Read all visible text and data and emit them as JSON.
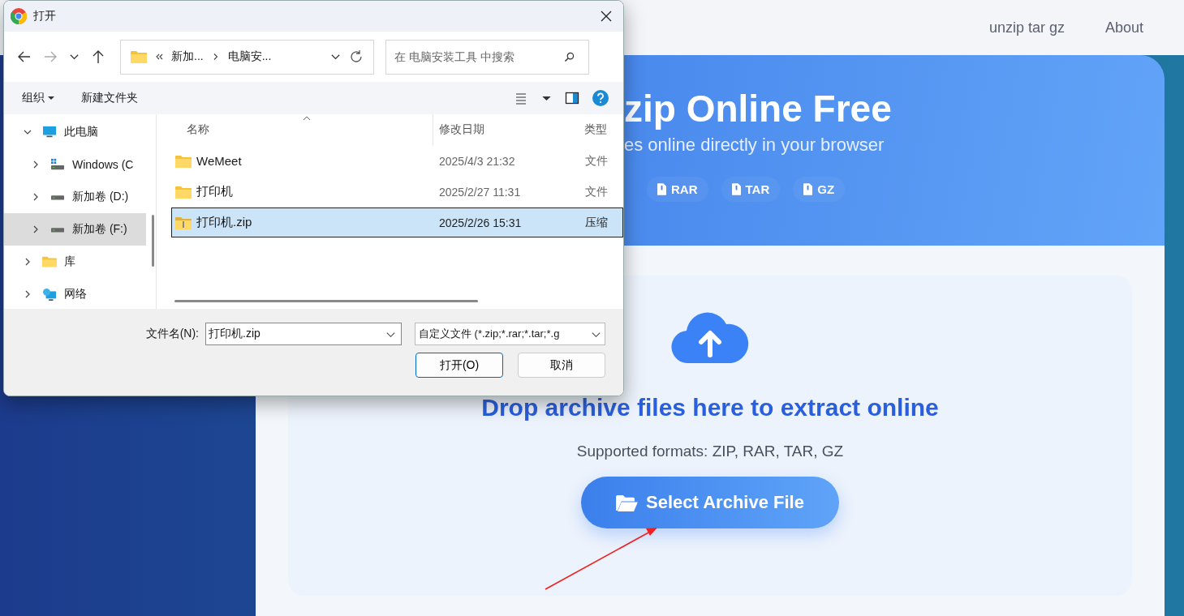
{
  "dialog": {
    "title": "打开",
    "address": [
      "新加...",
      "电脑安..."
    ],
    "search": {
      "placeholder": "在 电脑安装工具 中搜索"
    },
    "toolbar": {
      "organize": "组织",
      "new_folder": "新建文件夹"
    },
    "tree": [
      {
        "label": "此电脑",
        "kind": "computer",
        "expanded": true,
        "selected": false,
        "children": [
          {
            "label": "Windows (C",
            "kind": "system-drive",
            "expanded": false,
            "selected": false
          },
          {
            "label": "新加卷 (D:)",
            "kind": "drive",
            "expanded": false,
            "selected": false
          },
          {
            "label": "新加卷 (F:)",
            "kind": "drive",
            "expanded": false,
            "selected": true
          }
        ]
      },
      {
        "label": "库",
        "kind": "folder",
        "expanded": false,
        "selected": false
      },
      {
        "label": "网络",
        "kind": "network",
        "expanded": false,
        "selected": false
      }
    ],
    "columns": [
      "名称",
      "修改日期",
      "类型"
    ],
    "files": [
      {
        "name": "WeMeet",
        "date": "2025/4/3 21:32",
        "type": "文件",
        "kind": "folder",
        "selected": false
      },
      {
        "name": "打印机",
        "date": "2025/2/27 11:31",
        "type": "文件",
        "kind": "folder",
        "selected": false
      },
      {
        "name": "打印机.zip",
        "date": "2025/2/26 15:31",
        "type": "压缩",
        "kind": "zip",
        "selected": true
      }
    ],
    "filename": {
      "label": "文件名(N):",
      "value": "打印机.zip"
    },
    "filter": "自定义文件 (*.zip;*.rar;*.tar;*.g",
    "buttons": [
      "打开(O)",
      "取消"
    ]
  },
  "nav": [
    "unzip tar gz",
    "About"
  ],
  "hero": {
    "title": "zip Online Free",
    "subtitle": "es online directly in your browser",
    "formats": [
      "RAR",
      "TAR",
      "GZ"
    ]
  },
  "dropzone": {
    "title": "Drop archive files here to extract online",
    "formats_text": "Supported formats: ZIP, RAR, TAR, GZ",
    "button": "Select Archive File"
  }
}
